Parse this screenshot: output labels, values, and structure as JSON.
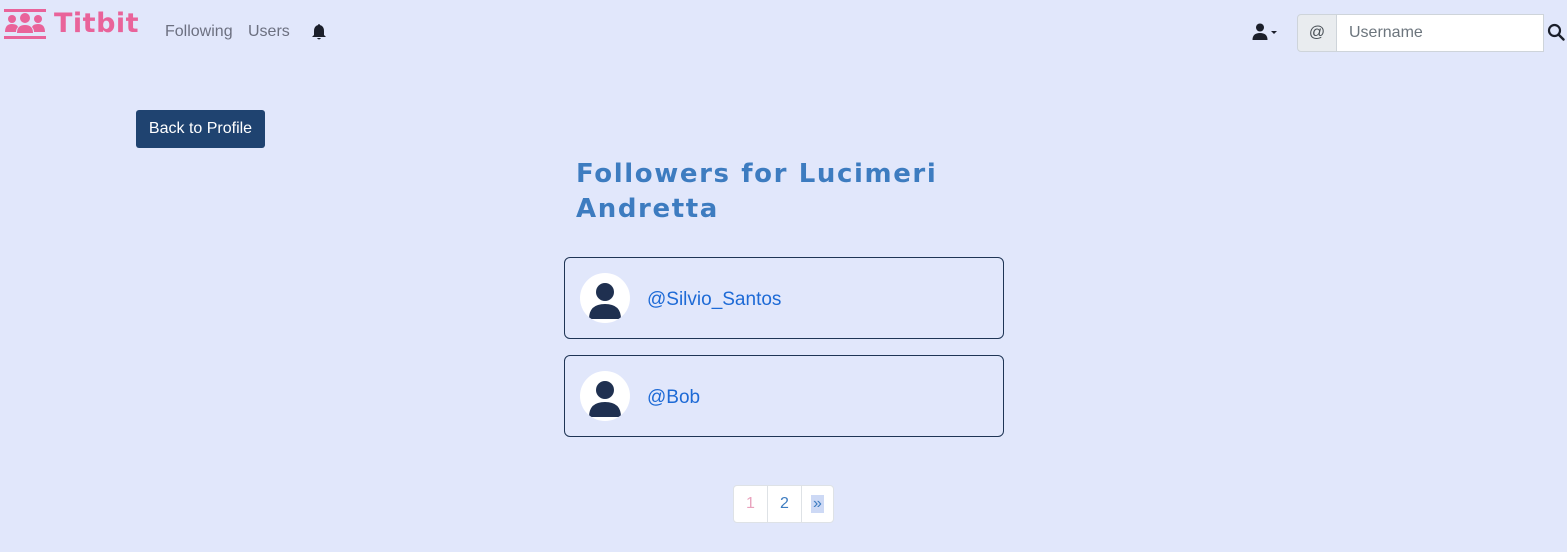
{
  "brand": {
    "name": "Titbit",
    "color": "#e9639a"
  },
  "nav": {
    "following_label": "Following",
    "users_label": "Users",
    "notifications_icon": "bell-icon"
  },
  "user_menu": {
    "icon": "user-icon",
    "caret": "caret-down-icon"
  },
  "search": {
    "prefix": "@",
    "placeholder": "Username",
    "value": "",
    "button_icon": "search-icon"
  },
  "back_button": {
    "label": "Back to Profile",
    "color": "#1f4370"
  },
  "page": {
    "title": "Followers for Lucimeri Andretta"
  },
  "followers": [
    {
      "username": "@Silvio_Santos",
      "avatar_icon": "user-avatar-icon"
    },
    {
      "username": "@Bob",
      "avatar_icon": "user-avatar-icon"
    }
  ],
  "pagination": {
    "current_page": 1,
    "pages": [
      "1",
      "2"
    ],
    "next_label": "»"
  },
  "colors": {
    "background": "#e1e7fb",
    "title": "#3d7cc0",
    "link": "#1d6ad6"
  }
}
